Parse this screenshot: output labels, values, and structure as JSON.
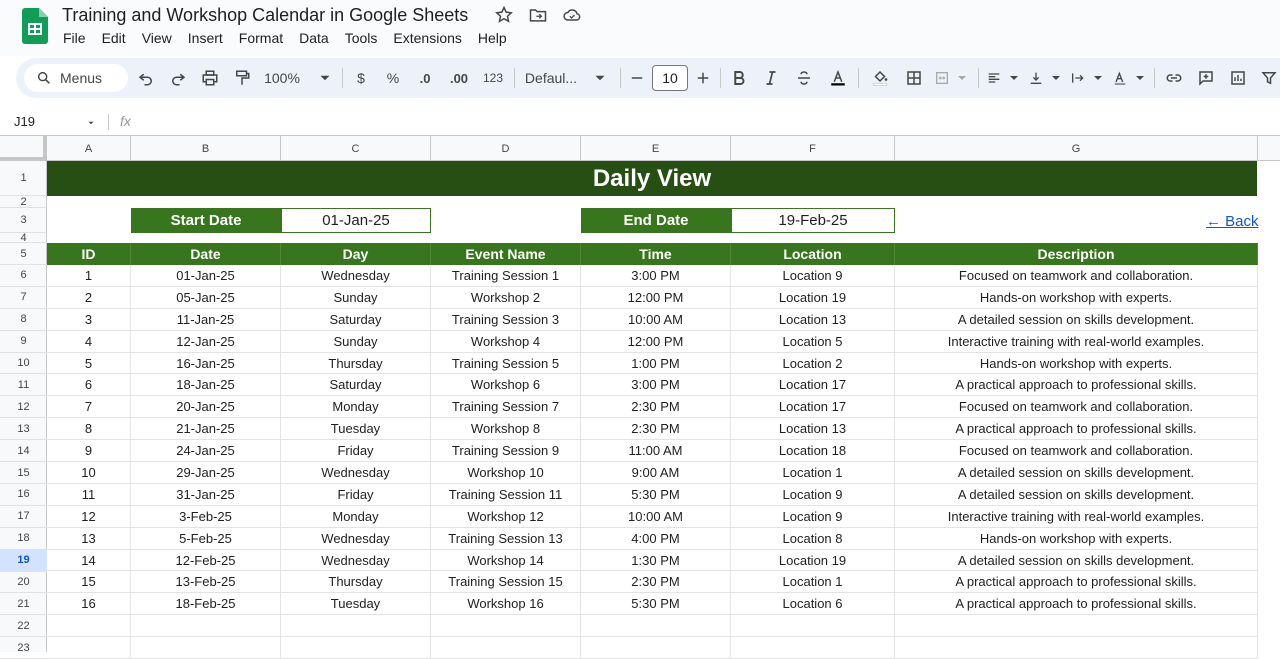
{
  "app": {
    "title": "Training and Workshop Calendar in Google Sheets",
    "menu": [
      "File",
      "Edit",
      "View",
      "Insert",
      "Format",
      "Data",
      "Tools",
      "Extensions",
      "Help"
    ]
  },
  "toolbar": {
    "menus_label": "Menus",
    "zoom": "100%",
    "currency": "$",
    "percent": "%",
    "dec_decrease": ".0",
    "dec_increase": ".00",
    "number_format": "123",
    "font": "Defaul...",
    "font_size": "10"
  },
  "formula_bar": {
    "cell_ref": "J19",
    "fx": "fx"
  },
  "columns": [
    "A",
    "B",
    "C",
    "D",
    "E",
    "F",
    "G"
  ],
  "rows": [
    "1",
    "2",
    "3",
    "4",
    "5",
    "6",
    "7",
    "8",
    "9",
    "10",
    "11",
    "12",
    "13",
    "14",
    "15",
    "16",
    "17",
    "18",
    "19",
    "20",
    "21",
    "22",
    "23"
  ],
  "selected_row": "19",
  "sheet": {
    "banner": "Daily View",
    "start_label": "Start Date",
    "start_value": "01-Jan-25",
    "end_label": "End Date",
    "end_value": "19-Feb-25",
    "back_link": "← Back",
    "headers": [
      "ID",
      "Date",
      "Day",
      "Event Name",
      "Time",
      "Location",
      "Description"
    ],
    "data": [
      [
        "1",
        "01-Jan-25",
        "Wednesday",
        "Training Session 1",
        "3:00 PM",
        "Location 9",
        "Focused on teamwork and collaboration."
      ],
      [
        "2",
        "05-Jan-25",
        "Sunday",
        "Workshop 2",
        "12:00 PM",
        "Location 19",
        "Hands-on workshop with experts."
      ],
      [
        "3",
        "11-Jan-25",
        "Saturday",
        "Training Session 3",
        "10:00 AM",
        "Location 13",
        "A detailed session on skills development."
      ],
      [
        "4",
        "12-Jan-25",
        "Sunday",
        "Workshop 4",
        "12:00 PM",
        "Location 5",
        "Interactive training with real-world examples."
      ],
      [
        "5",
        "16-Jan-25",
        "Thursday",
        "Training Session 5",
        "1:00 PM",
        "Location 2",
        "Hands-on workshop with experts."
      ],
      [
        "6",
        "18-Jan-25",
        "Saturday",
        "Workshop 6",
        "3:00 PM",
        "Location 17",
        "A practical approach to professional skills."
      ],
      [
        "7",
        "20-Jan-25",
        "Monday",
        "Training Session 7",
        "2:30 PM",
        "Location 17",
        "Focused on teamwork and collaboration."
      ],
      [
        "8",
        "21-Jan-25",
        "Tuesday",
        "Workshop 8",
        "2:30 PM",
        "Location 13",
        "A practical approach to professional skills."
      ],
      [
        "9",
        "24-Jan-25",
        "Friday",
        "Training Session 9",
        "11:00 AM",
        "Location 18",
        "Focused on teamwork and collaboration."
      ],
      [
        "10",
        "29-Jan-25",
        "Wednesday",
        "Workshop 10",
        "9:00 AM",
        "Location 1",
        "A detailed session on skills development."
      ],
      [
        "11",
        "31-Jan-25",
        "Friday",
        "Training Session 11",
        "5:30 PM",
        "Location 9",
        "A detailed session on skills development."
      ],
      [
        "12",
        "3-Feb-25",
        "Monday",
        "Workshop 12",
        "10:00 AM",
        "Location 9",
        "Interactive training with real-world examples."
      ],
      [
        "13",
        "5-Feb-25",
        "Wednesday",
        "Training Session 13",
        "4:00 PM",
        "Location 8",
        "Hands-on workshop with experts."
      ],
      [
        "14",
        "12-Feb-25",
        "Wednesday",
        "Workshop 14",
        "1:30 PM",
        "Location 19",
        "A detailed session on skills development."
      ],
      [
        "15",
        "13-Feb-25",
        "Thursday",
        "Training Session 15",
        "2:30 PM",
        "Location 1",
        "A practical approach to professional skills."
      ],
      [
        "16",
        "18-Feb-25",
        "Tuesday",
        "Workshop 16",
        "5:30 PM",
        "Location 6",
        "A practical approach to professional skills."
      ]
    ]
  },
  "colors": {
    "banner": "#274e13",
    "header": "#38761d",
    "link": "#1155cc"
  }
}
